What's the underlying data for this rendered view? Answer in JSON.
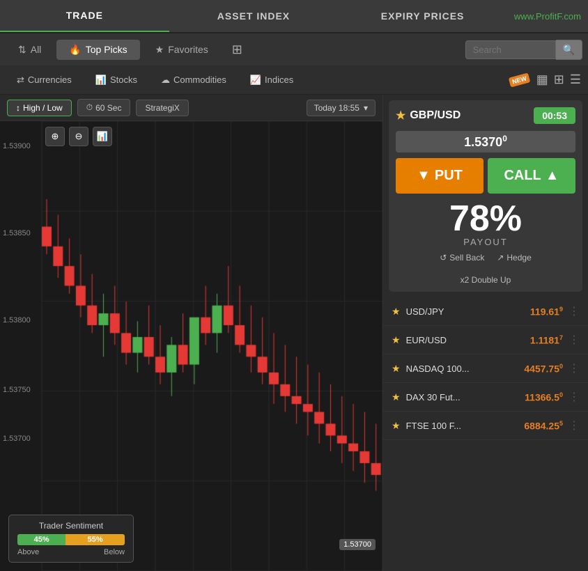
{
  "topNav": {
    "items": [
      "TRADE",
      "ASSET INDEX",
      "EXPIRY PRICES"
    ],
    "rightLink": "www.ProfitF.com"
  },
  "tabs": {
    "all": "All",
    "topPicks": "Top Picks",
    "favorites": "Favorites",
    "search": {
      "placeholder": "Search",
      "buttonLabel": "🔍"
    }
  },
  "categories": {
    "currencies": "Currencies",
    "stocks": "Stocks",
    "commodities": "Commodities",
    "indices": "Indices"
  },
  "chartControls": {
    "mode": "High / Low",
    "duration": "60 Sec",
    "strategy": "StrategiX",
    "time": "Today 18:55"
  },
  "chart": {
    "yLabels": [
      "1.53900",
      "1.53850",
      "1.53800",
      "1.53750",
      "1.53700"
    ],
    "currentPrice": "1.53700"
  },
  "traderSentiment": {
    "title": "Trader Sentiment",
    "abovePercent": "45%",
    "belowPercent": "55%",
    "aboveLabel": "Above",
    "belowLabel": "Below",
    "aboveWidth": 45,
    "belowWidth": 55
  },
  "tradingWidget": {
    "pair": "GBP/USD",
    "timer": "00:53",
    "price": "1.5370",
    "priceSup": "0",
    "putLabel": "PUT",
    "callLabel": "CALL",
    "payoutPercent": "78%",
    "payoutLabel": "PAYOUT",
    "actions": {
      "sellBack": "Sell Back",
      "hedge": "Hedge",
      "doubleUp": "x2 Double Up"
    }
  },
  "instruments": [
    {
      "name": "USD/JPY",
      "price": "119.61",
      "priceSup": "9"
    },
    {
      "name": "EUR/USD",
      "price": "1.1181",
      "priceSup": "7"
    },
    {
      "name": "NASDAQ 100...",
      "price": "4457.75",
      "priceSup": "0"
    },
    {
      "name": "DAX 30 Fut...",
      "price": "11366.5",
      "priceSup": "0"
    },
    {
      "name": "FTSE 100 F...",
      "price": "6884.25",
      "priceSup": "5"
    }
  ]
}
